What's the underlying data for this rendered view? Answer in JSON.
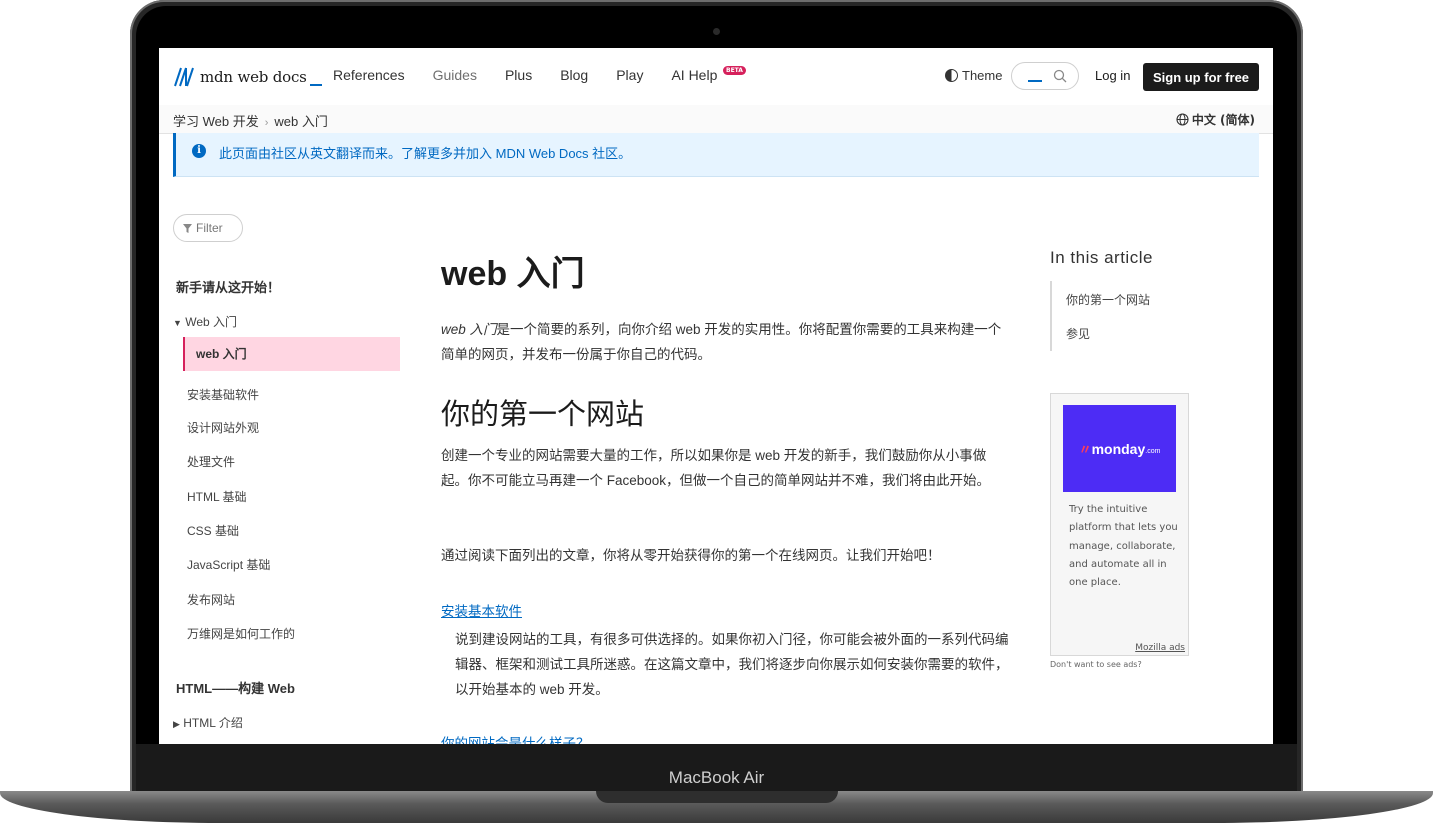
{
  "device": {
    "label": "MacBook Air"
  },
  "header": {
    "logo_text": "mdn web docs",
    "nav": [
      "References",
      "Guides",
      "Plus",
      "Blog",
      "Play",
      "AI Help"
    ],
    "beta_badge": "BETA",
    "theme_label": "Theme",
    "login_label": "Log in",
    "signup_label": "Sign up for free"
  },
  "breadcrumb": {
    "items": [
      "学习 Web 开发",
      "web 入门"
    ],
    "language": "中文 (简体)"
  },
  "notice": {
    "text": "此页面由社区从英文翻译而来。了解更多并加入 MDN Web Docs 社区。"
  },
  "sidebar": {
    "filter_label": "Filter",
    "section1_title": "新手请从这开始！",
    "group_label": "Web 入门",
    "active_item": "web 入门",
    "items": [
      "安装基础软件",
      "设计网站外观",
      "处理文件",
      "HTML 基础",
      "CSS 基础",
      "JavaScript 基础",
      "发布网站",
      "万维网是如何工作的"
    ],
    "section2_title": "HTML——构建 Web",
    "section2_item": "HTML 介绍"
  },
  "article": {
    "title": "web 入门",
    "intro_em": "web 入门",
    "intro_rest": "是一个简要的系列，向你介绍 web 开发的实用性。你将配置你需要的工具来构建一个简单的网页，并发布一份属于你自己的代码。",
    "h2": "你的第一个网站",
    "p1": "创建一个专业的网站需要大量的工作，所以如果你是 web 开发的新手，我们鼓励你从小事做起。你不可能立马再建一个 Facebook，但做一个自己的简单网站并不难，我们将由此开始。",
    "p2": "通过阅读下面列出的文章，你将从零开始获得你的第一个在线网页。让我们开始吧！",
    "link1": "安装基本软件",
    "link1_desc": "说到建设网站的工具，有很多可供选择的。如果你初入门径，你可能会被外面的一系列代码编辑器、框架和测试工具所迷惑。在这篇文章中，我们将逐步向你展示如何安装你需要的软件，以开始基本的 web 开发。",
    "link2": "你的网站会是什么样子？"
  },
  "toc": {
    "title": "In this article",
    "items": [
      "你的第一个网站",
      "参见"
    ]
  },
  "ad": {
    "brand": "monday",
    "brand_suffix": ".com",
    "text": "Try the intuitive platform that lets you manage, collaborate, and automate all in one place.",
    "link": "Mozilla ads",
    "no_ads": "Don't want to see ads?"
  },
  "colors": {
    "accent": "#0069c2",
    "active_bg": "#ffd6e2",
    "active_border": "#d6215c",
    "ad_bg": "#4d2cf5"
  }
}
